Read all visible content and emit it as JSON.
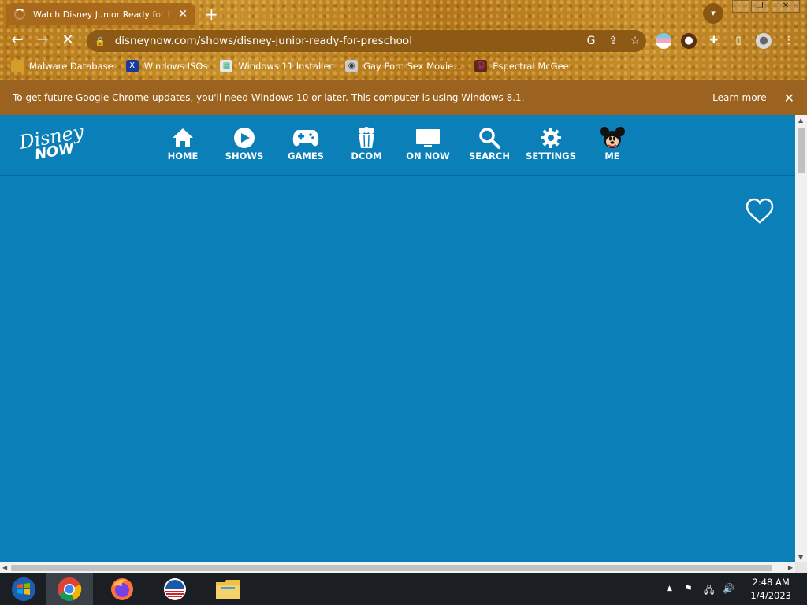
{
  "browser": {
    "tab_title": "Watch Disney Junior Ready for Preschool",
    "tab_close": "✕",
    "new_tab": "+",
    "url": "disneynow.com/shows/disney-junior-ready-for-preschool",
    "bookmarks": [
      {
        "label": "Malware Database",
        "icon": "folder-icon"
      },
      {
        "label": "Windows ISOs",
        "icon": "x-icon"
      },
      {
        "label": "Windows 11 Installer",
        "icon": "image-icon"
      },
      {
        "label": "Gay Porn Sex Movie...",
        "icon": "disc-icon"
      },
      {
        "label": "Espectral McGee",
        "icon": "avatar-icon"
      }
    ]
  },
  "infobar": {
    "message": "To get future Google Chrome updates, you'll need Windows 10 or later. This computer is using Windows 8.1.",
    "learn_more": "Learn more",
    "close": "✕"
  },
  "site": {
    "logo_line1": "Disney",
    "logo_line2": "NOW",
    "nav": [
      {
        "label": "HOME",
        "icon": "home-icon"
      },
      {
        "label": "SHOWS",
        "icon": "play-icon"
      },
      {
        "label": "GAMES",
        "icon": "gamepad-icon"
      },
      {
        "label": "DCOM",
        "icon": "popcorn-icon"
      },
      {
        "label": "ON NOW",
        "icon": "tv-icon"
      },
      {
        "label": "SEARCH",
        "icon": "search-icon"
      },
      {
        "label": "SETTINGS",
        "icon": "gear-icon"
      },
      {
        "label": "ME",
        "icon": "mickey-icon"
      }
    ]
  },
  "taskbar": {
    "time": "2:48 AM",
    "date": "1/4/2023"
  },
  "colors": {
    "page_bg": "#0a7fb8",
    "infobar_bg": "#9c6220",
    "taskbar_bg": "#1b1f24"
  }
}
